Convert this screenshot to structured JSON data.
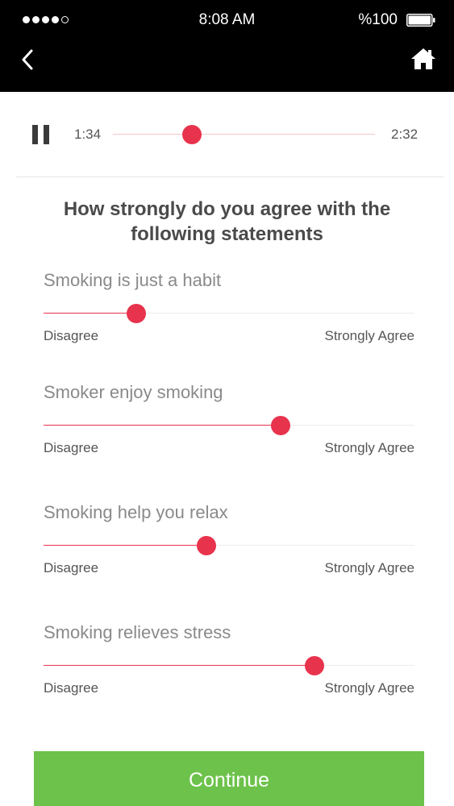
{
  "status_bar": {
    "signal_dots": [
      true,
      true,
      true,
      true,
      false
    ],
    "time": "8:08 AM",
    "battery": "%100",
    "battery_level": 1.0
  },
  "nav": {
    "back_icon": "chevron-left-icon",
    "home_icon": "home-icon"
  },
  "player": {
    "state_icon": "pause-icon",
    "current_time": "1:34",
    "total_time": "2:32",
    "progress_fraction": 0.3
  },
  "survey": {
    "question": "How strongly do you agree with the following statements",
    "statements": [
      {
        "label": "Smoking is just a habit",
        "min_label": "Disagree",
        "max_label": "Strongly Agree",
        "value": 0.25
      },
      {
        "label": "Smoker enjoy smoking",
        "min_label": "Disagree",
        "max_label": "Strongly Agree",
        "value": 0.64
      },
      {
        "label": "Smoking help you relax",
        "min_label": "Disagree",
        "max_label": "Strongly Agree",
        "value": 0.44
      },
      {
        "label": "Smoking relieves stress",
        "min_label": "Disagree",
        "max_label": "Strongly Agree",
        "value": 0.73
      }
    ]
  },
  "continue_label": "Continue",
  "colors": {
    "accent": "#e8334d",
    "track": "#ececec",
    "button": "#6cc24a",
    "header": "#000000"
  }
}
